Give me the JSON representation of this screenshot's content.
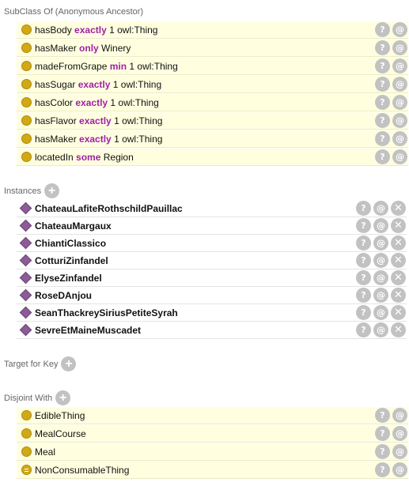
{
  "subclass_section": {
    "title": "SubClass Of (Anonymous Ancestor)",
    "rows": [
      {
        "property": "hasBody",
        "keyword": "exactly",
        "filler": "1 owl:Thing"
      },
      {
        "property": "hasMaker",
        "keyword": "only",
        "filler": "Winery"
      },
      {
        "property": "madeFromGrape",
        "keyword": "min",
        "filler": "1 owl:Thing"
      },
      {
        "property": "hasSugar",
        "keyword": "exactly",
        "filler": "1 owl:Thing"
      },
      {
        "property": "hasColor",
        "keyword": "exactly",
        "filler": "1 owl:Thing"
      },
      {
        "property": "hasFlavor",
        "keyword": "exactly",
        "filler": "1 owl:Thing"
      },
      {
        "property": "hasMaker",
        "keyword": "exactly",
        "filler": "1 owl:Thing"
      },
      {
        "property": "locatedIn",
        "keyword": "some",
        "filler": "Region"
      }
    ]
  },
  "instances_section": {
    "title": "Instances",
    "items": [
      "ChateauLafiteRothschildPauillac",
      "ChateauMargaux",
      "ChiantiClassico",
      "CotturiZinfandel",
      "ElyseZinfandel",
      "RoseDAnjou",
      "SeanThackreySiriusPetiteSyrah",
      "SevreEtMaineMuscadet"
    ]
  },
  "target_for_key_section": {
    "title": "Target for Key"
  },
  "disjoint_section": {
    "title": "Disjoint With",
    "items": [
      {
        "label": "EdibleThing",
        "icon": "class-icon"
      },
      {
        "label": "MealCourse",
        "icon": "class-icon"
      },
      {
        "label": "Meal",
        "icon": "class-icon"
      },
      {
        "label": "NonConsumableThing",
        "icon": "equivalent-class-icon"
      }
    ]
  },
  "buttons": {
    "add": "+",
    "explain": "?",
    "annotate": "@",
    "delete": "✕"
  },
  "colors": {
    "inferred_row_bg": "#ffffe0",
    "keyword": "#a020a8",
    "class_icon": "#d1a916",
    "individual_icon": "#8b5c96",
    "action_button": "#c2c2c2",
    "header_text": "#666666"
  }
}
